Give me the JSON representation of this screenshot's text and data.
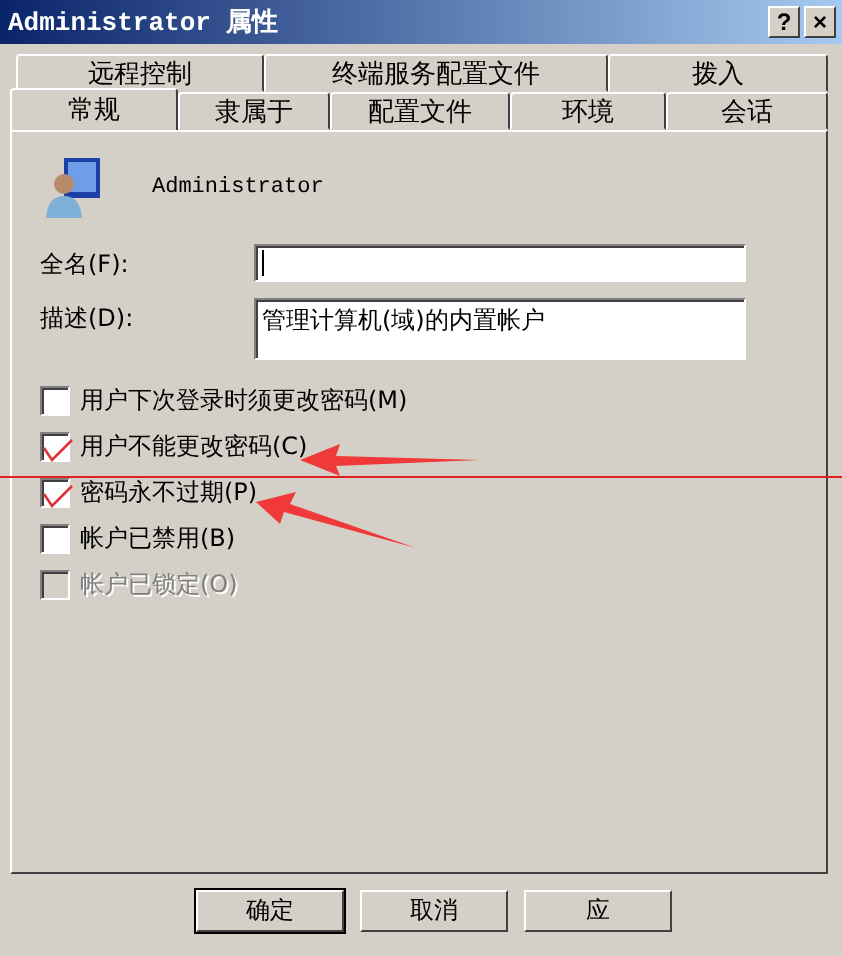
{
  "window": {
    "title": "Administrator 属性"
  },
  "title_buttons": [
    "?",
    "×"
  ],
  "tab_rows": [
    [
      {
        "label": "远程控制",
        "selected": false
      },
      {
        "label": "终端服务配置文件",
        "selected": false
      },
      {
        "label": "拨入",
        "selected": false
      }
    ],
    [
      {
        "label": "常规",
        "selected": true
      },
      {
        "label": "隶属于",
        "selected": false
      },
      {
        "label": "配置文件",
        "selected": false
      },
      {
        "label": "环境",
        "selected": false
      },
      {
        "label": "会话",
        "selected": false
      }
    ]
  ],
  "user": {
    "name": "Administrator"
  },
  "fields": [
    {
      "label": "全名(F):"
    },
    {
      "label": "描述(D):",
      "value": "管理计算机(域)的内置帐户"
    }
  ],
  "options": [
    {
      "label": "用户下次登录时须更改密码(M)",
      "checked": false,
      "disabled": false
    },
    {
      "label": "用户不能更改密码(C)",
      "checked": true,
      "disabled": false
    },
    {
      "label": "密码永不过期(P)",
      "checked": true,
      "disabled": false
    },
    {
      "label": "帐户已禁用(B)",
      "checked": false,
      "disabled": false
    },
    {
      "label": "帐户已锁定(O)",
      "checked": false,
      "disabled": true
    }
  ],
  "buttons": [
    "确定",
    "取消",
    "应"
  ]
}
